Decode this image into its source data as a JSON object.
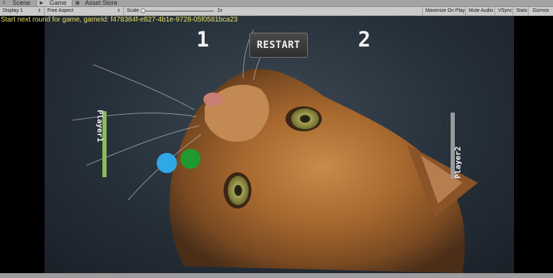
{
  "tabs": [
    {
      "label": "Scene",
      "icon": "scene-icon"
    },
    {
      "label": "Game",
      "icon": "game-icon"
    },
    {
      "label": "Asset Store",
      "icon": "store-icon"
    }
  ],
  "toolbar": {
    "display": "Display 1",
    "aspect": "Free Aspect",
    "scale_label": "Scale",
    "scale_value": "2x",
    "scale_level": 0.0,
    "maximize": "Maximize On Play",
    "mute": "Mute Audio",
    "vsync": "VSync",
    "stats": "Stats",
    "gizmos": "Gizmos"
  },
  "game": {
    "status_message": "Start next round for game, gameId: f478384f-e827-4b1e-9728-05f0581bca23",
    "score_left": "1",
    "score_right": "2",
    "restart_label": "RESTART",
    "player1_label": "Player1",
    "player2_label": "Player2"
  },
  "colors": {
    "player1_paddle": "#8dbb5a",
    "player2_paddle": "#9a9a9a",
    "ball_blue": "#2ea9e6",
    "ball_green": "#1f9a2e",
    "status_text": "#e8e06a"
  }
}
